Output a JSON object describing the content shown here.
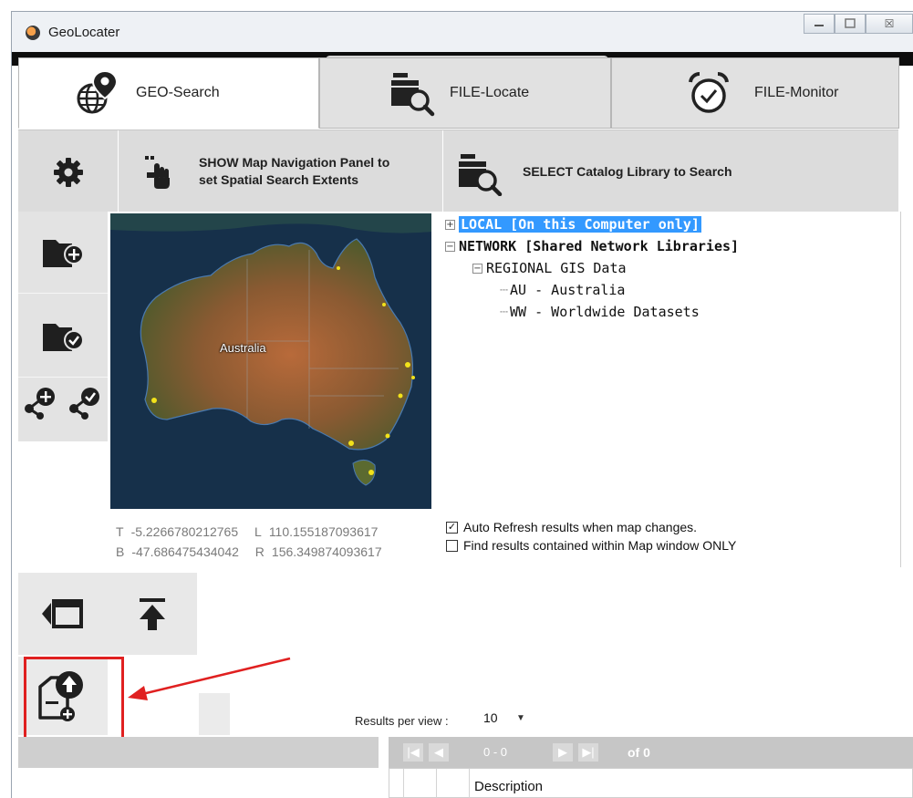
{
  "window": {
    "title": "GeoLocater",
    "buttons": [
      "minimize-icon",
      "maximize-icon",
      "close-icon"
    ],
    "close_glyph": "☒"
  },
  "tabs": [
    {
      "label": "GEO-Search",
      "icon": "globe-pin-icon",
      "active": true
    },
    {
      "label": "FILE-Locate",
      "icon": "folder-search-icon",
      "active": false
    },
    {
      "label": "FILE-Monitor",
      "icon": "alarm-clock-icon",
      "active": false
    }
  ],
  "toolbar": {
    "settings_icon": "gear-icon",
    "map_nav_label_1": "SHOW Map Navigation Panel to",
    "map_nav_label_2": "set Spatial Search Extents",
    "catalog_label": "SELECT Catalog Library to Search"
  },
  "map": {
    "label": "Australia"
  },
  "coords": {
    "t_key": "T",
    "t_value": "-5.2266780212765",
    "l_key": "L",
    "l_value": "110.155187093617",
    "b_key": "B",
    "b_value": "-47.686475434042",
    "r_key": "R",
    "r_value": "156.349874093617"
  },
  "tree": {
    "local": "LOCAL  [On this Computer only]",
    "network": "NETWORK  [Shared Network Libraries]",
    "regional": "REGIONAL GIS Data",
    "au": "AU - Australia",
    "ww": "WW - Worldwide Datasets",
    "expand_plus": "+",
    "expand_minus": "−"
  },
  "options": {
    "auto_refresh": "Auto Refresh results when map changes.",
    "auto_refresh_checked": true,
    "map_window_only": "Find results contained within Map window ONLY",
    "map_window_only_checked": false
  },
  "results": {
    "per_view_label": "Results per view :",
    "per_view_value": "10",
    "range": "0 - 0",
    "of": "of 0",
    "column": "Description"
  },
  "colors": {
    "selection": "#3399ff",
    "highlight": "#e02020"
  }
}
